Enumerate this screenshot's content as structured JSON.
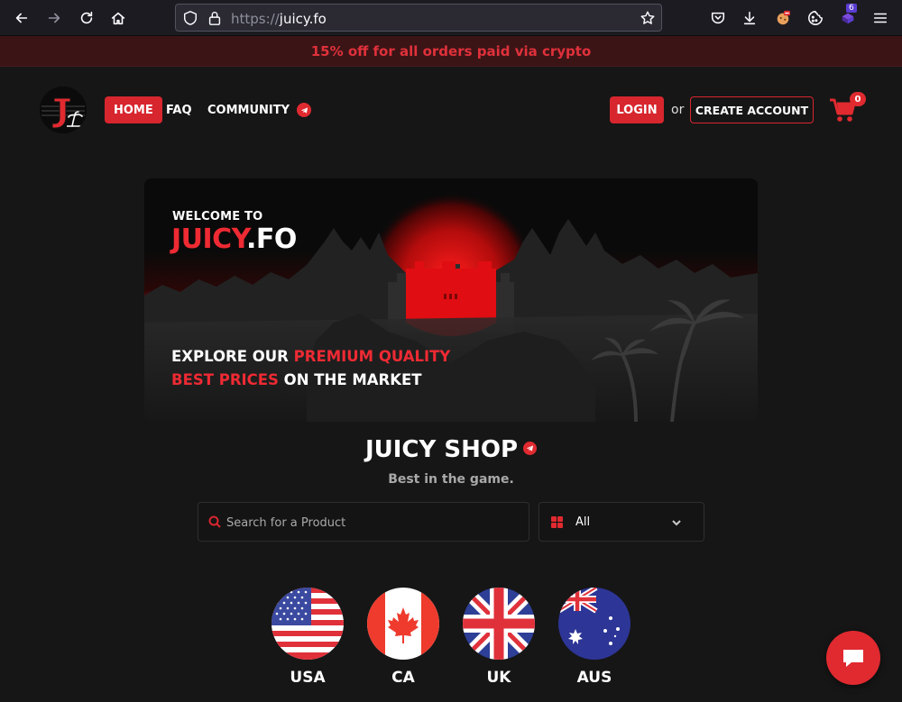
{
  "browser": {
    "url_prefix": "https://",
    "url_host": "juicy.fo",
    "extension_badge": "6"
  },
  "promo": {
    "text": "15% off for all orders paid via crypto"
  },
  "header": {
    "nav": [
      {
        "label": "HOME"
      },
      {
        "label": "FAQ"
      },
      {
        "label": "COMMUNITY"
      }
    ],
    "login": "LOGIN",
    "or": "or",
    "create_account": "CREATE ACCOUNT",
    "cart_count": "0"
  },
  "banner": {
    "welcome": "WELCOME TO",
    "brand_red": "JUICY",
    "brand_white": ".FO",
    "line1_white": "EXPLORE OUR ",
    "line1_red": "PREMIUM QUALITY",
    "line2_red": "BEST PRICES",
    "line2_white": " ON THE MARKET"
  },
  "shop": {
    "title": "JUICY SHOP",
    "subtitle": "Best in the game.",
    "search_placeholder": "Search for a Product",
    "category_selected": "All"
  },
  "countries": [
    {
      "label": "USA"
    },
    {
      "label": "CA"
    },
    {
      "label": "UK"
    },
    {
      "label": "AUS"
    }
  ],
  "colors": {
    "accent": "#d7262e",
    "background": "#161616",
    "promo_bg": "#3b1416"
  }
}
